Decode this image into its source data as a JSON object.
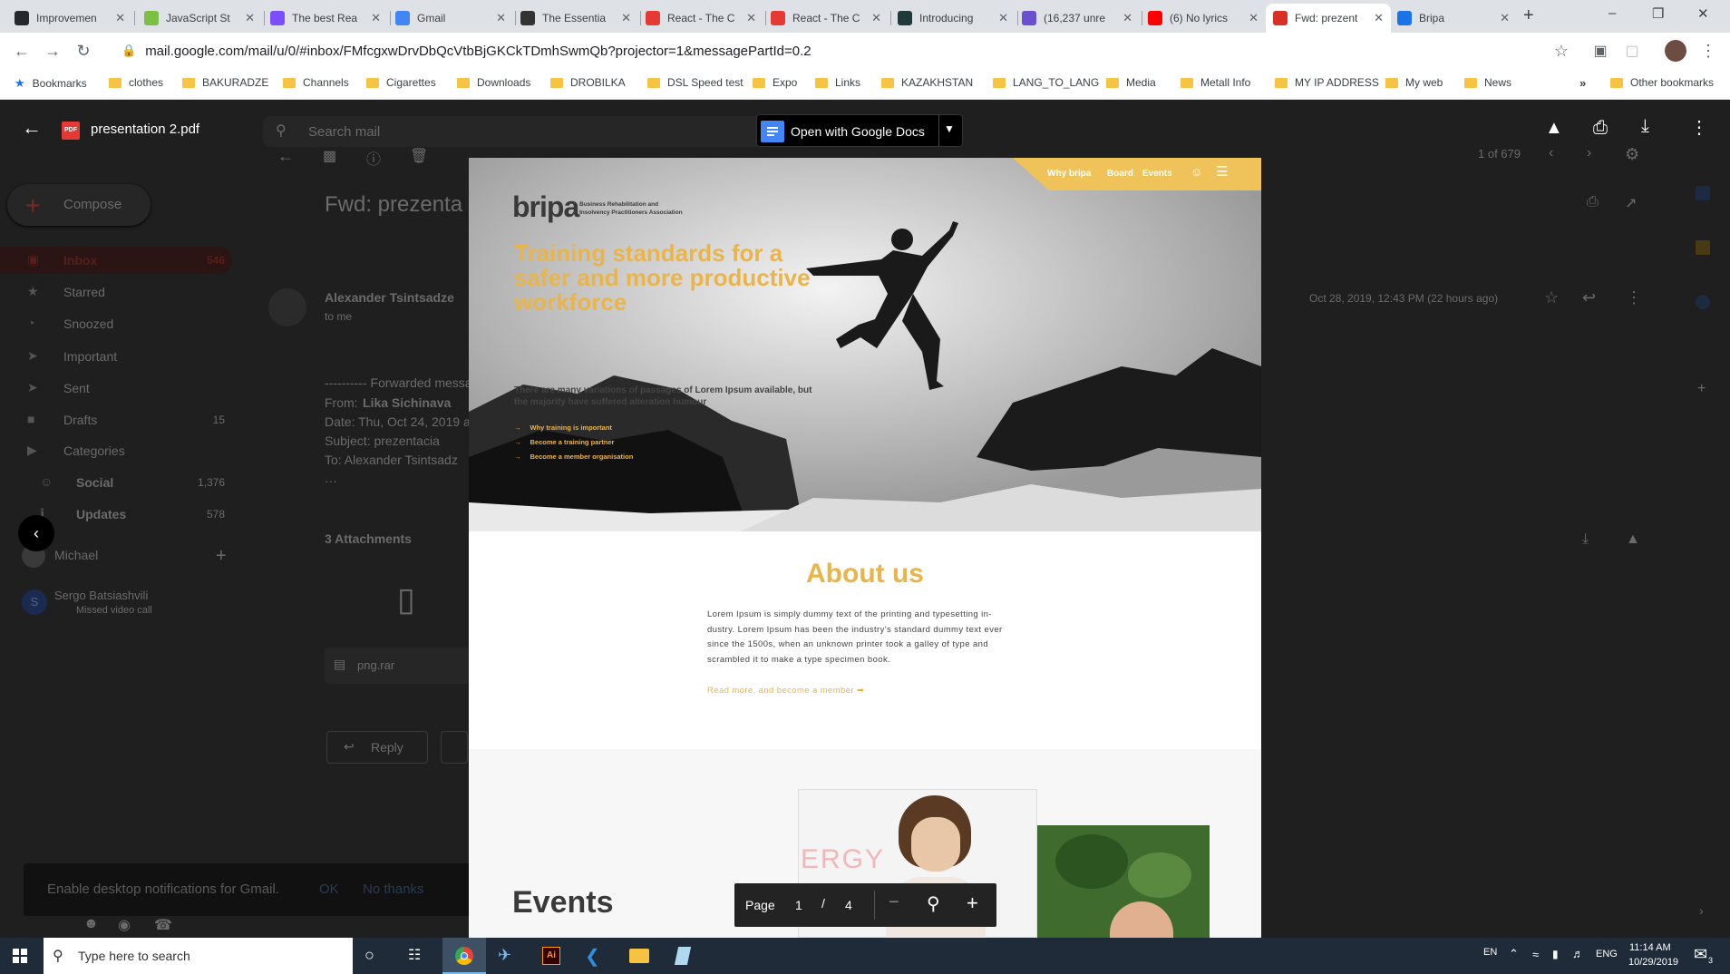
{
  "browser": {
    "tabs": [
      {
        "title": "Improvemen",
        "icon": "github-icon",
        "color": "#24292e"
      },
      {
        "title": "JavaScript St",
        "icon": "site-icon",
        "color": "#7bc043"
      },
      {
        "title": "The best Rea",
        "icon": "site-icon",
        "color": "#7c4dff"
      },
      {
        "title": "Gmail",
        "icon": "google-icon",
        "color": "#4285f4"
      },
      {
        "title": "The Essentia",
        "icon": "site-icon",
        "color": "#333333"
      },
      {
        "title": "React - The C",
        "icon": "site-icon",
        "color": "#e53935"
      },
      {
        "title": "React - The C",
        "icon": "site-icon",
        "color": "#e53935"
      },
      {
        "title": "Introducing",
        "icon": "site-icon",
        "color": "#1e3a3a"
      },
      {
        "title": "(16,237 unre",
        "icon": "mail-icon",
        "color": "#6a4fcf"
      },
      {
        "title": "(6) No lyrics",
        "icon": "youtube-icon",
        "color": "#ff0000"
      },
      {
        "title": "Fwd: prezent",
        "icon": "gmail-icon",
        "color": "#d93025",
        "active": true
      },
      {
        "title": "Bripa",
        "icon": "globe-icon",
        "color": "#1a73e8"
      }
    ],
    "url": "mail.google.com/mail/u/0/#inbox/FMfcgxwDrvDbQcVtbBjGKCkTDmhSwmQb?projector=1&messagePartId=0.2",
    "bookmarks": [
      "Bookmarks",
      "clothes",
      "BAKURADZE",
      "Channels",
      "Cigarettes",
      "Downloads",
      "DROBILKA",
      "DSL Speed test",
      "Expo",
      "Links",
      "KAZAKHSTAN",
      "LANG_TO_LANG",
      "Media",
      "Metall Info",
      "MY IP ADDRESS",
      "My web",
      "News"
    ],
    "other_bookmarks": "Other bookmarks"
  },
  "gmail": {
    "search_placeholder": "Search mail",
    "compose": "Compose",
    "nav": [
      {
        "label": "Inbox",
        "count": "546"
      },
      {
        "label": "Starred",
        "count": ""
      },
      {
        "label": "Snoozed",
        "count": ""
      },
      {
        "label": "Important",
        "count": ""
      },
      {
        "label": "Sent",
        "count": ""
      },
      {
        "label": "Drafts",
        "count": "15"
      },
      {
        "label": "Categories",
        "count": ""
      },
      {
        "label": "Social",
        "count": "1,376"
      },
      {
        "label": "Updates",
        "count": "578"
      }
    ],
    "account": "Michael",
    "chat_contact": "Sergo Batsiashvili",
    "chat_status": "Missed video call",
    "subject": "Fwd: prezenta",
    "sender": "Alexander Tsintsadze",
    "to_me": "to me",
    "date": "Oct 28, 2019, 12:43 PM (22 hours ago)",
    "pagination": "1 of 679",
    "forwarded_header": "---------- Forwarded messa",
    "from_label": "From:",
    "from_name": "Lika Sichinava",
    "date_line": "Date: Thu, Oct 24, 2019 a",
    "subject_line": "Subject: prezentacia",
    "to_line": "To: Alexander Tsintsadz",
    "attachments_title": "3 Attachments",
    "attachment_file": "png.rar",
    "reply": "Reply",
    "notification": "Enable desktop notifications for Gmail.",
    "notif_ok": "OK",
    "notif_no": "No thanks"
  },
  "viewer": {
    "filename": "presentation 2.pdf",
    "open_with": "Open with Google Docs",
    "page_label": "Page",
    "current_page": "1",
    "slash": "/",
    "total_pages": "4"
  },
  "pdf": {
    "nav_links": [
      "Why bripa",
      "Board",
      "Events"
    ],
    "logo": "bripa",
    "logo_sub1": "Business Rehabilitation and",
    "logo_sub2": "Insolvency Practitioners Association",
    "headline_1": "Training standards for a",
    "headline_2": "safer and more productive",
    "headline_3": "workforce",
    "intro_1": "There are many variations of passages of Lorem Ipsum available, but",
    "intro_2": "the majority have suffered alteration humour",
    "links": [
      "Why training is important",
      "Become a training partner",
      "Become a member organisation"
    ],
    "about_title": "About us",
    "about_lines": [
      "Lorem Ipsum is simply dummy text of the printing and typesetting in-",
      "dustry. Lorem Ipsum has been the industry's standard dummy text ever",
      "since the 1500s, when an unknown printer took a galley of type and",
      "scrambled it to make a type specimen book."
    ],
    "read_more": "Read more, and become a member ➡",
    "whiteboard_text": "ERGY",
    "events_title": "Events",
    "accent": "#e9b54a"
  },
  "taskbar": {
    "search_placeholder": "Type here to search",
    "lang1": "EN",
    "lang2": "ENG",
    "time": "11:14 AM",
    "date": "10/29/2019",
    "notif_count": "3"
  }
}
